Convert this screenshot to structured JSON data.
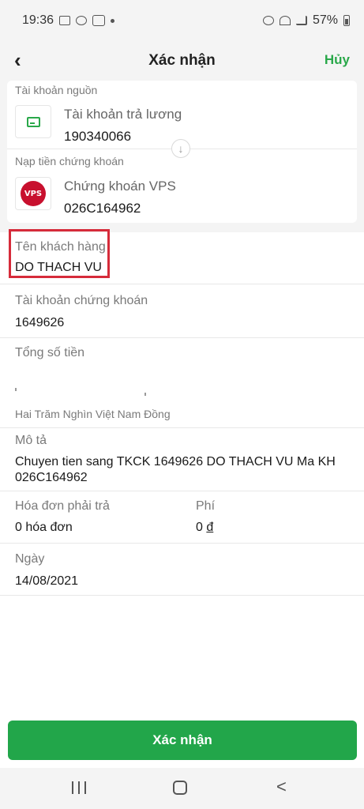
{
  "status_bar": {
    "time": "19:36",
    "battery_percent": "57%"
  },
  "header": {
    "back_icon": "‹",
    "title": "Xác nhận",
    "cancel_label": "Hủy"
  },
  "source_card": {
    "source_label": "Tài khoản nguồn",
    "source_name": "Tài khoản trả lương",
    "source_number": "190340066",
    "target_label": "Nạp tiền chứng khoán",
    "target_name": "Chứng khoán VPS",
    "target_number": "026C164962",
    "logo_text": "VPS",
    "arrow_icon": "↓"
  },
  "details": {
    "customer_label": "Tên khách hàng",
    "customer_value": "DO THACH VU",
    "account_label": "Tài khoản chứng khoán",
    "account_value": "1649626",
    "amount_label": "Tổng số tiền",
    "amount_words": "Hai Trăm Nghìn Việt Nam Đồng",
    "desc_label": "Mô tả",
    "desc_value": "Chuyen tien sang TKCK 1649626 DO THACH VU Ma KH 026C164962",
    "bills_label": "Hóa đơn phải trả",
    "bills_value": "0 hóa đơn",
    "fee_label": "Phí",
    "fee_value": "0",
    "fee_currency": "đ",
    "date_label": "Ngày",
    "date_value": "14/08/2021"
  },
  "confirm_button": "Xác nhận",
  "colors": {
    "accent": "#22a64a",
    "highlight": "#d62b3a"
  }
}
